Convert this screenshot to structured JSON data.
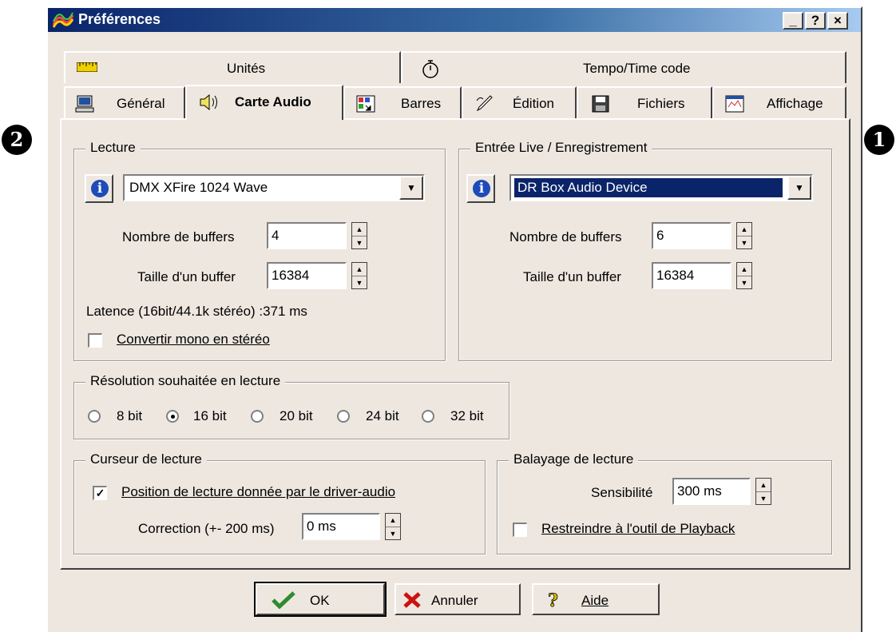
{
  "window": {
    "title": "Préférences",
    "controls": {
      "minimize": "_",
      "help": "?",
      "close": "×"
    }
  },
  "tabs_back": [
    {
      "label": "Unités",
      "icon": "ruler-icon"
    },
    {
      "label": "Tempo/Time code",
      "icon": "stopwatch-icon"
    }
  ],
  "tabs_front": [
    {
      "label": "Général",
      "icon": "computer-icon"
    },
    {
      "label": "Carte Audio",
      "icon": "speaker-icon",
      "active": true
    },
    {
      "label": "Barres",
      "icon": "bars-icon"
    },
    {
      "label": "Édition",
      "icon": "edit-icon"
    },
    {
      "label": "Fichiers",
      "icon": "floppy-icon"
    },
    {
      "label": "Affichage",
      "icon": "display-icon"
    }
  ],
  "markers": {
    "left": "2",
    "right": "1"
  },
  "lecture": {
    "title": "Lecture",
    "device": "DMX XFire 1024 Wave",
    "buffers_label": "Nombre de buffers",
    "buffers_value": "4",
    "size_label": "Taille d'un buffer",
    "size_value": "16384",
    "latency": "Latence (16bit/44.1k stéréo) :371 ms",
    "mono_label": "Convertir mono en stéréo",
    "mono_checked": false
  },
  "live": {
    "title": "Entrée Live / Enregistrement",
    "device": "DR Box Audio Device",
    "buffers_label": "Nombre de buffers",
    "buffers_value": "6",
    "size_label": "Taille d'un buffer",
    "size_value": "16384"
  },
  "resolution": {
    "title": "Résolution souhaitée en lecture",
    "options": [
      "8 bit",
      "16 bit",
      "20 bit",
      "24 bit",
      "32 bit"
    ],
    "selected": "16 bit"
  },
  "curseur": {
    "title": "Curseur de lecture",
    "position_label": "Position de lecture donnée par le driver-audio",
    "position_checked": true,
    "correction_label": "Correction (+- 200 ms)",
    "correction_value": "0 ms"
  },
  "balayage": {
    "title": "Balayage de lecture",
    "sens_label": "Sensibilité",
    "sens_value": "300 ms",
    "restrict_label": "Restreindre à l'outil de Playback",
    "restrict_checked": false
  },
  "buttons": {
    "ok": "OK",
    "cancel": "Annuler",
    "help": "Aide"
  },
  "colors": {
    "title_bar": "#0a246a",
    "face": "#ede7e0",
    "selection": "#0a246a",
    "info": "#1d4bb8",
    "ok_check": "#2e8b2e",
    "cancel_x": "#cc1111"
  }
}
